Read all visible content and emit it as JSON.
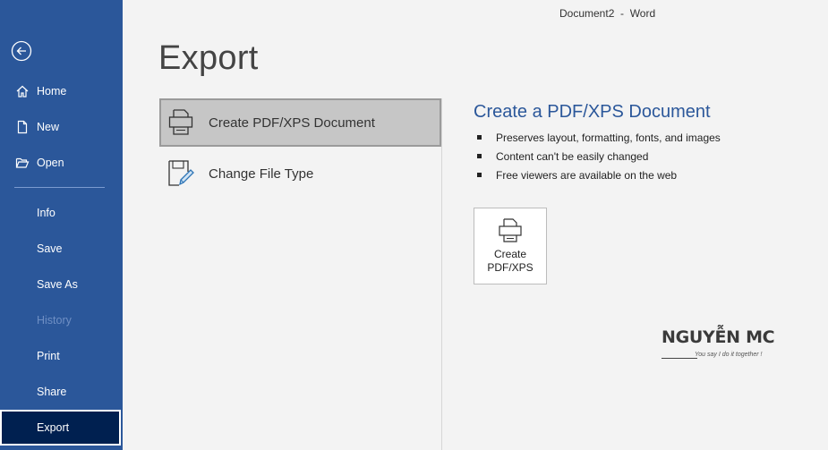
{
  "window": {
    "title": "Document2  -  Word"
  },
  "sidebar": {
    "items": [
      {
        "label": "Home",
        "icon": "home-icon"
      },
      {
        "label": "New",
        "icon": "new-document-icon"
      },
      {
        "label": "Open",
        "icon": "folder-open-icon"
      },
      {
        "label": "Info"
      },
      {
        "label": "Save"
      },
      {
        "label": "Save As"
      },
      {
        "label": "History",
        "state": "disabled"
      },
      {
        "label": "Print"
      },
      {
        "label": "Share"
      },
      {
        "label": "Export",
        "state": "selected"
      }
    ]
  },
  "main": {
    "title": "Export",
    "options": [
      {
        "label": "Create PDF/XPS Document",
        "icon": "pdf-document-icon",
        "selected": true
      },
      {
        "label": "Change File Type",
        "icon": "change-file-type-icon",
        "selected": false
      }
    ],
    "detail": {
      "title": "Create a PDF/XPS Document",
      "bullets": [
        "Preserves layout, formatting, fonts, and images",
        "Content can't be easily changed",
        "Free viewers are available on the web"
      ],
      "button_line1": "Create",
      "button_line2": "PDF/XPS"
    }
  },
  "watermark": {
    "title": "NGUYỄN MC",
    "subtitle": "You say I do it together !"
  },
  "colors": {
    "sidebar_bg": "#2b579a",
    "sidebar_selected": "#002050",
    "accent_title": "#2b579a",
    "background": "#f3f3f3"
  }
}
